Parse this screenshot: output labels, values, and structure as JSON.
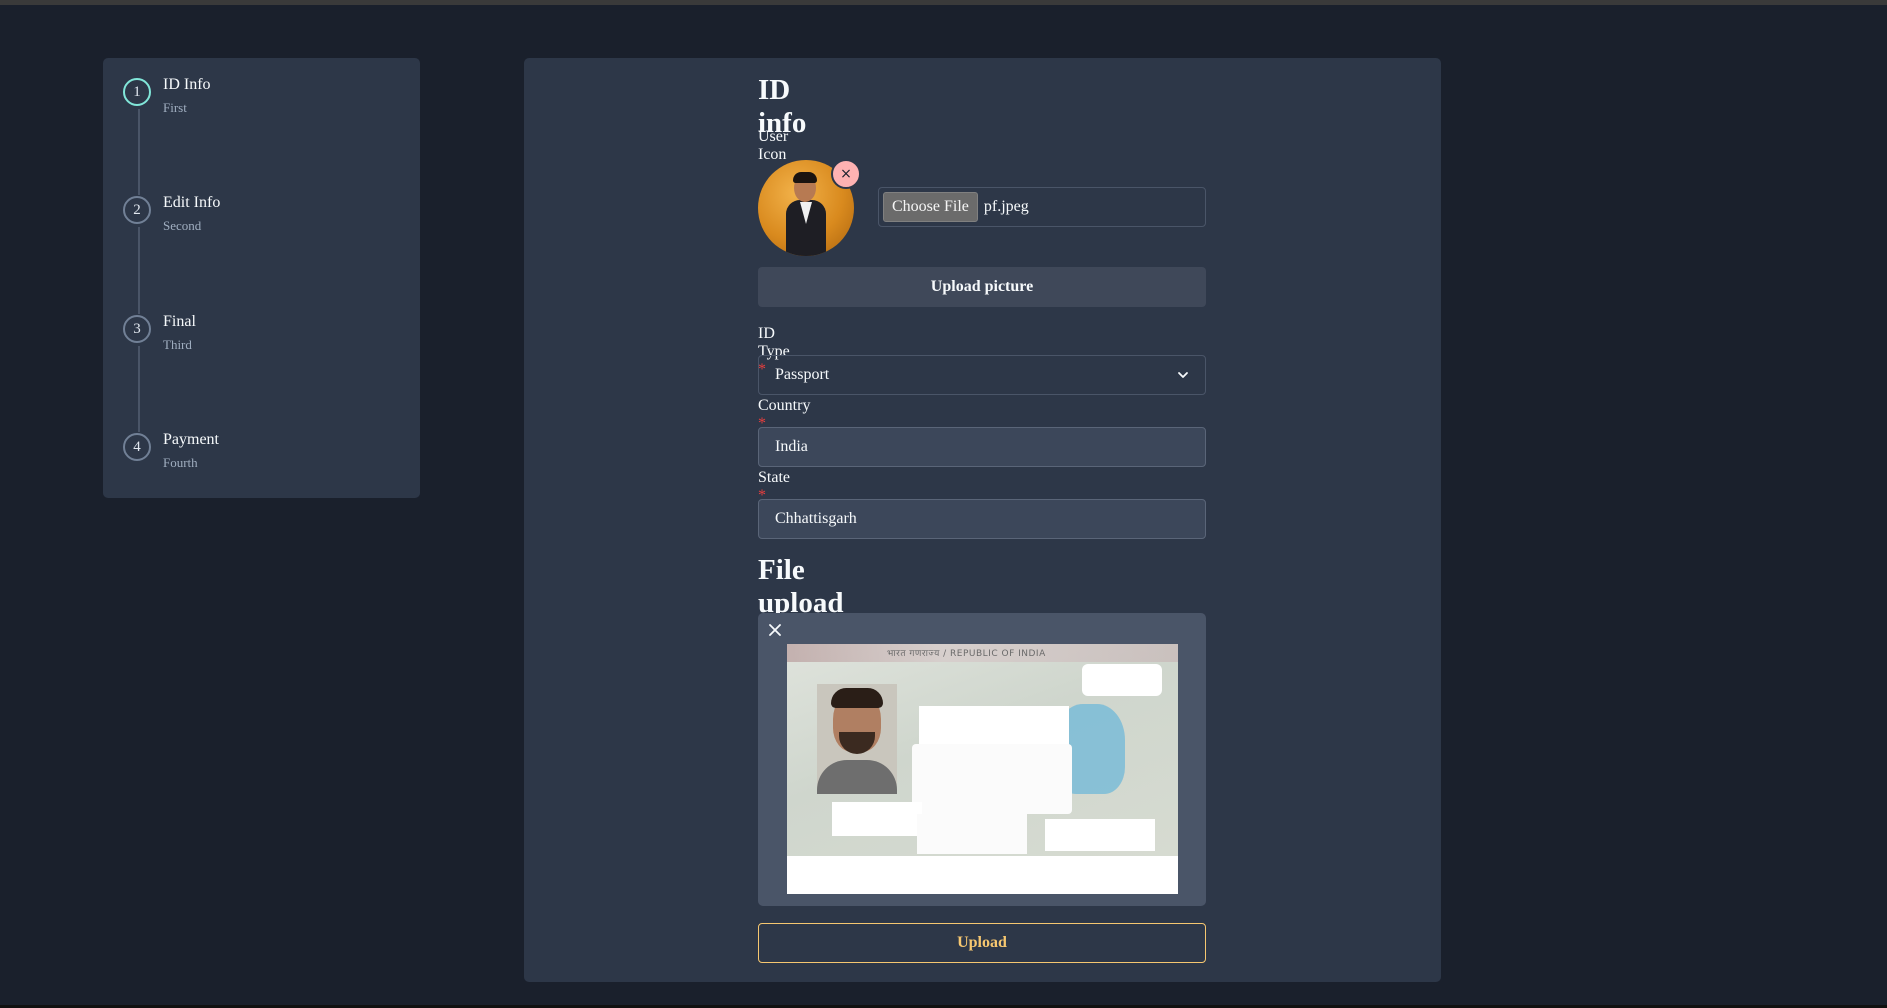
{
  "steps": [
    {
      "number": "1",
      "title": "ID Info",
      "subtitle": "First",
      "active": true
    },
    {
      "number": "2",
      "title": "Edit Info",
      "subtitle": "Second",
      "active": false
    },
    {
      "number": "3",
      "title": "Final",
      "subtitle": "Third",
      "active": false
    },
    {
      "number": "4",
      "title": "Payment",
      "subtitle": "Fourth",
      "active": false
    }
  ],
  "form": {
    "heading": "ID info",
    "user_icon_label": "User Icon",
    "remove_icon": "×",
    "choose_file_label": "Choose File",
    "file_name": "pf.jpeg",
    "upload_picture_label": "Upload picture",
    "id_type_label": "ID Type",
    "id_type_value": "Passport",
    "country_label": "Country",
    "country_value": "India",
    "state_label": "State",
    "state_value": "Chhattisgarh",
    "required_mark": "*"
  },
  "file_upload": {
    "heading": "File upload",
    "passport_header": "भारत गणराज्य / REPUBLIC OF INDIA",
    "upload_label": "Upload"
  },
  "colors": {
    "background": "#1a202c",
    "panel": "#2d3748",
    "active_step": "#81e6d9",
    "required": "#e53e3e",
    "upload_accent": "#f6c770"
  }
}
